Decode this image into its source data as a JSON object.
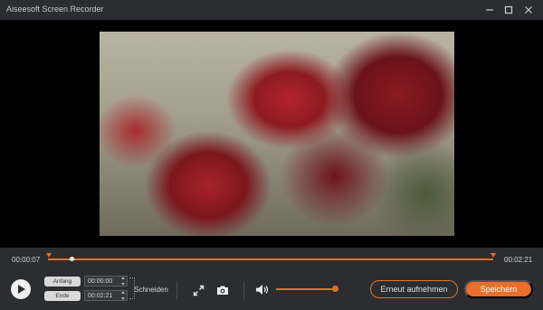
{
  "window": {
    "title": "Aiseesoft Screen Recorder",
    "controls": [
      "minimize-icon",
      "maximize-icon",
      "close-icon"
    ]
  },
  "timeline": {
    "current_time": "00:00:07",
    "total_time": "00:02:21",
    "playhead_fraction": 0.05
  },
  "trim": {
    "start_label": "Anfang",
    "start_value": "00:00:00",
    "end_label": "Ende",
    "end_value": "00:02:21",
    "cut_label": "Schneiden"
  },
  "tools": {
    "icons": [
      "expand-icon",
      "camera-icon",
      "volume-icon"
    ]
  },
  "volume": {
    "level_fraction": 1.0
  },
  "buttons": {
    "rerecord": "Erneut aufnehmen",
    "save": "Speichern"
  },
  "colors": {
    "accent": "#e8702a",
    "background": "#2b2d31",
    "video_bg": "#000000"
  }
}
